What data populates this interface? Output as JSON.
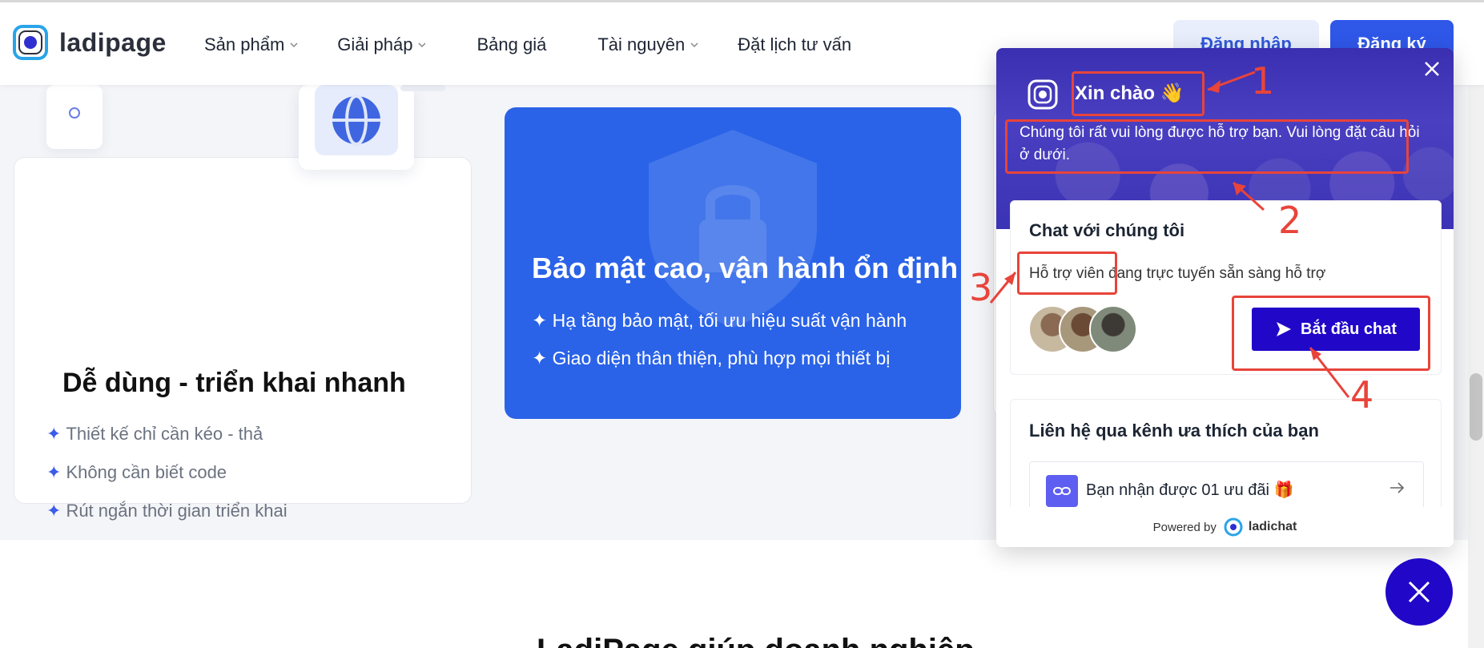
{
  "header": {
    "logo_text": "ladipage",
    "nav": [
      {
        "label": "Sản phẩm",
        "has_dropdown": true
      },
      {
        "label": "Giải pháp",
        "has_dropdown": true
      },
      {
        "label": "Bảng giá",
        "has_dropdown": false
      },
      {
        "label": "Tài nguyên",
        "has_dropdown": true
      },
      {
        "label": "Đặt lịch tư vấn",
        "has_dropdown": false
      }
    ],
    "login_label": "Đăng nhập",
    "register_label": "Đăng ký"
  },
  "features": {
    "card1": {
      "title": "Dễ dùng - triển khai nhanh",
      "bullets": [
        "Thiết kế chỉ cần kéo - thả",
        "Không cần biết code",
        "Rút ngắn thời gian triển khai"
      ]
    },
    "card2": {
      "title": "Bảo mật cao, vận hành ổn định",
      "bullets": [
        "Hạ tầng bảo mật, tối ưu hiệu suất vận hành",
        "Giao diện thân thiện, phù hợp mọi thiết bị"
      ]
    },
    "bullet_symbol": "✦"
  },
  "bottom_heading": "LadiPage giúp doanh nghiệp",
  "chat": {
    "greeting": "Xin chào 👋",
    "intro": "Chúng tôi rất vui lòng được hỗ trợ bạn. Vui lòng đặt câu hỏi ở dưới.",
    "card_title": "Chat với chúng tôi",
    "card_subtitle": "Hỗ trợ viên đang trực tuyến sẵn sàng hỗ trợ",
    "start_label": "Bắt đầu chat",
    "contact_title": "Liên hệ qua kênh ưa thích của bạn",
    "offer_text": "Bạn nhận được 01 ưu đãi 🎁",
    "powered_by": "Powered by",
    "brand": "ladichat"
  },
  "annotations": {
    "labels": [
      "1",
      "2",
      "3",
      "4"
    ],
    "color": "#e8443a"
  },
  "colors": {
    "brand_blue": "#2f57e8",
    "chat_primary": "#2107c8",
    "feature_blue": "#2a63e8"
  }
}
